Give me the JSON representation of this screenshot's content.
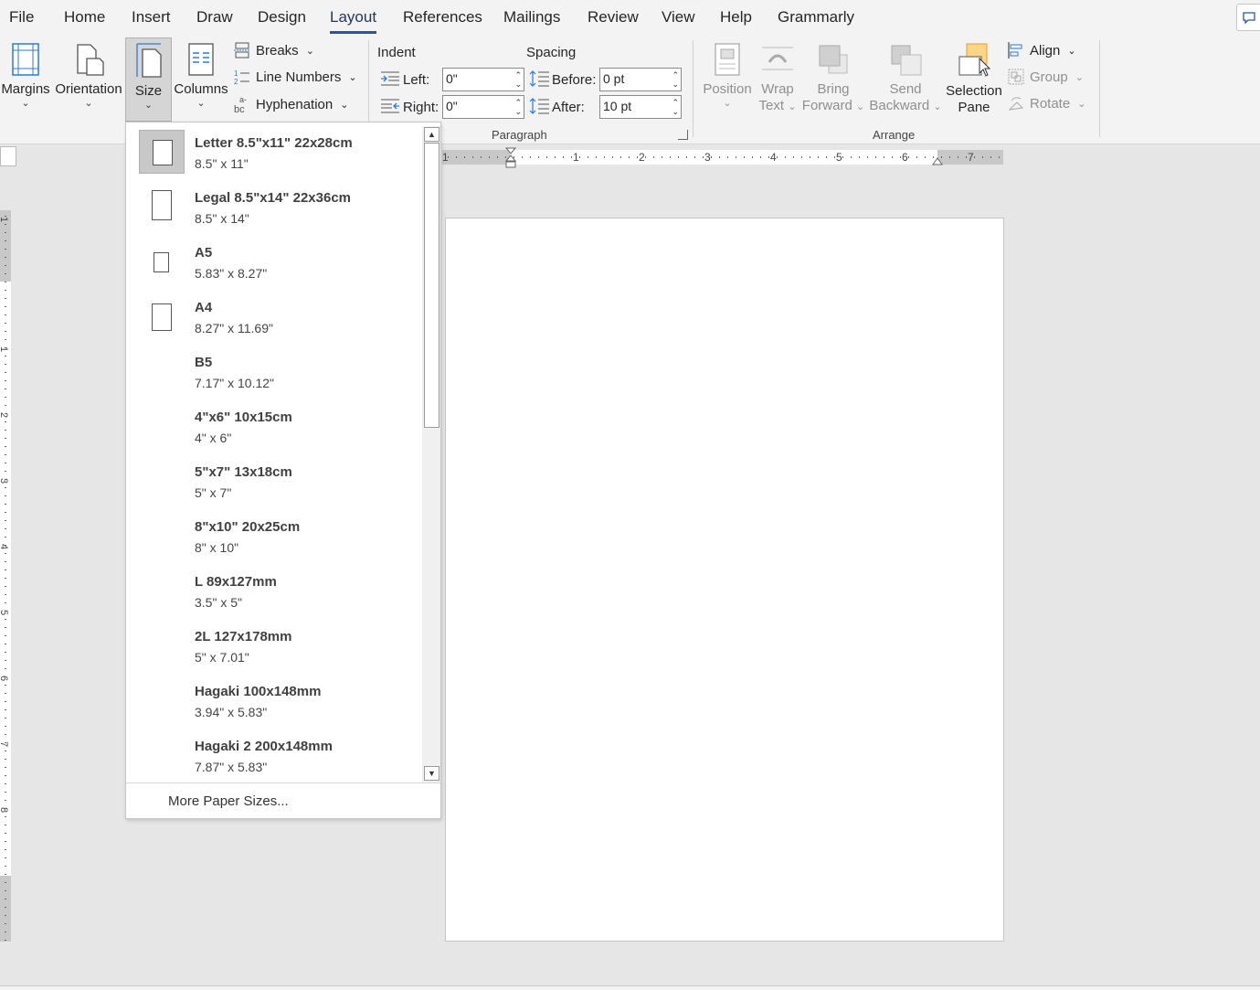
{
  "tabs": [
    "File",
    "Home",
    "Insert",
    "Draw",
    "Design",
    "Layout",
    "References",
    "Mailings",
    "Review",
    "View",
    "Help",
    "Grammarly"
  ],
  "active_tab": "Layout",
  "page_setup": {
    "margins": "Margins",
    "orientation": "Orientation",
    "size": "Size",
    "columns": "Columns",
    "breaks": "Breaks",
    "line_numbers": "Line Numbers",
    "hyphenation": "Hyphenation"
  },
  "paragraph": {
    "indent_title": "Indent",
    "spacing_title": "Spacing",
    "left_label": "Left:",
    "left_value": "0\"",
    "right_label": "Right:",
    "right_value": "0\"",
    "before_label": "Before:",
    "before_value": "0 pt",
    "after_label": "After:",
    "after_value": "10 pt",
    "group_label": "Paragraph"
  },
  "arrange": {
    "position": "Position",
    "wrap_1": "Wrap",
    "wrap_2": "Text",
    "bring_1": "Bring",
    "bring_2": "Forward",
    "send_1": "Send",
    "send_2": "Backward",
    "selection_1": "Selection",
    "selection_2": "Pane",
    "align": "Align",
    "group": "Group",
    "rotate": "Rotate",
    "group_label": "Arrange"
  },
  "ruler": {
    "h_numbers": [
      "1",
      "1",
      "2",
      "3",
      "4",
      "5",
      "6",
      "7"
    ],
    "v_numbers": [
      "1",
      "1",
      "2",
      "3",
      "4",
      "5",
      "6",
      "7",
      "8"
    ]
  },
  "size_menu": {
    "items": [
      {
        "name": "Letter 8.5\"x11\" 22x28cm",
        "dims": "8.5\" x 11\"",
        "selected": true
      },
      {
        "name": "Legal 8.5\"x14\" 22x36cm",
        "dims": "8.5\" x 14\""
      },
      {
        "name": "A5",
        "dims": "5.83\" x 8.27\""
      },
      {
        "name": "A4",
        "dims": "8.27\" x 11.69\""
      },
      {
        "name": "B5",
        "dims": "7.17\" x 10.12\""
      },
      {
        "name": "4\"x6\" 10x15cm",
        "dims": "4\" x 6\""
      },
      {
        "name": "5\"x7\" 13x18cm",
        "dims": "5\" x 7\""
      },
      {
        "name": "8\"x10\" 20x25cm",
        "dims": "8\" x 10\""
      },
      {
        "name": "L 89x127mm",
        "dims": "3.5\" x 5\""
      },
      {
        "name": "2L 127x178mm",
        "dims": "5\" x 7.01\""
      },
      {
        "name": "Hagaki 100x148mm",
        "dims": "3.94\" x 5.83\""
      },
      {
        "name": "Hagaki 2 200x148mm",
        "dims": "7.87\" x 5.83\""
      }
    ],
    "more": "More Paper Sizes..."
  }
}
